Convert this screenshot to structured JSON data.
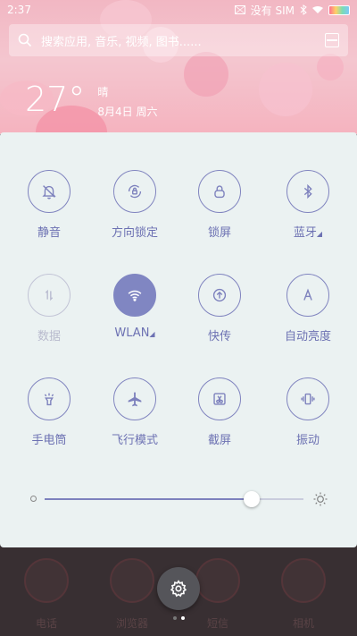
{
  "status": {
    "time": "2:37",
    "carrier": "没有 SIM"
  },
  "search": {
    "placeholder": "搜索应用, 音乐, 视频, 图书......"
  },
  "weather": {
    "temperature": "27°",
    "condition": "晴",
    "date": "8月4日 周六"
  },
  "toggles": [
    {
      "label": "静音",
      "icon": "mute-bell-icon",
      "state": "off"
    },
    {
      "label": "方向锁定",
      "icon": "rotation-lock-icon",
      "state": "off"
    },
    {
      "label": "锁屏",
      "icon": "lock-icon",
      "state": "off"
    },
    {
      "label": "蓝牙",
      "icon": "bluetooth-icon",
      "state": "off"
    },
    {
      "label": "数据",
      "icon": "mobile-data-icon",
      "state": "disabled"
    },
    {
      "label": "WLAN",
      "icon": "wifi-icon",
      "state": "on"
    },
    {
      "label": "快传",
      "icon": "quick-transfer-icon",
      "state": "off"
    },
    {
      "label": "自动亮度",
      "icon": "auto-brightness-icon",
      "state": "off"
    },
    {
      "label": "手电筒",
      "icon": "flashlight-icon",
      "state": "off"
    },
    {
      "label": "飞行模式",
      "icon": "airplane-icon",
      "state": "off"
    },
    {
      "label": "截屏",
      "icon": "screenshot-icon",
      "state": "off"
    },
    {
      "label": "振动",
      "icon": "vibrate-icon",
      "state": "off"
    }
  ],
  "brightness": {
    "level": 0.8
  },
  "dock": [
    {
      "label": "电话"
    },
    {
      "label": "浏览器"
    },
    {
      "label": "短信"
    },
    {
      "label": "相机"
    }
  ],
  "colors": {
    "accent": "#8086c2",
    "panel_bg": "#ebf2f2",
    "wallpaper_pink": "#f2b7c3"
  }
}
